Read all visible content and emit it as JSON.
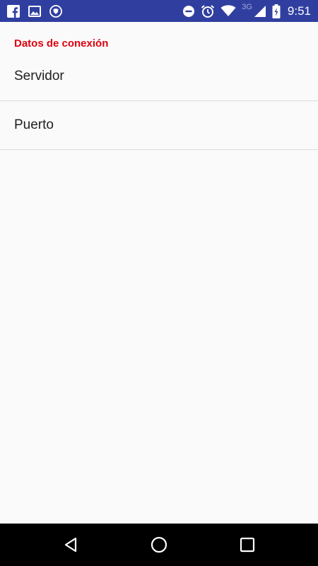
{
  "status_bar": {
    "time": "9:51",
    "network_label": "3G",
    "left_icons": [
      "facebook-icon",
      "image-icon",
      "vpn-shield-icon"
    ],
    "right_icons": [
      "do-not-disturb-icon",
      "alarm-icon",
      "wifi-icon",
      "cell-signal-icon",
      "battery-charging-icon"
    ],
    "background_color": "#303f9f"
  },
  "settings": {
    "category_title": "Datos de conexión",
    "category_color": "#e0000f",
    "items": [
      {
        "label": "Servidor"
      },
      {
        "label": "Puerto"
      }
    ]
  },
  "nav_bar": {
    "buttons": [
      "back-icon",
      "home-icon",
      "recents-icon"
    ]
  }
}
